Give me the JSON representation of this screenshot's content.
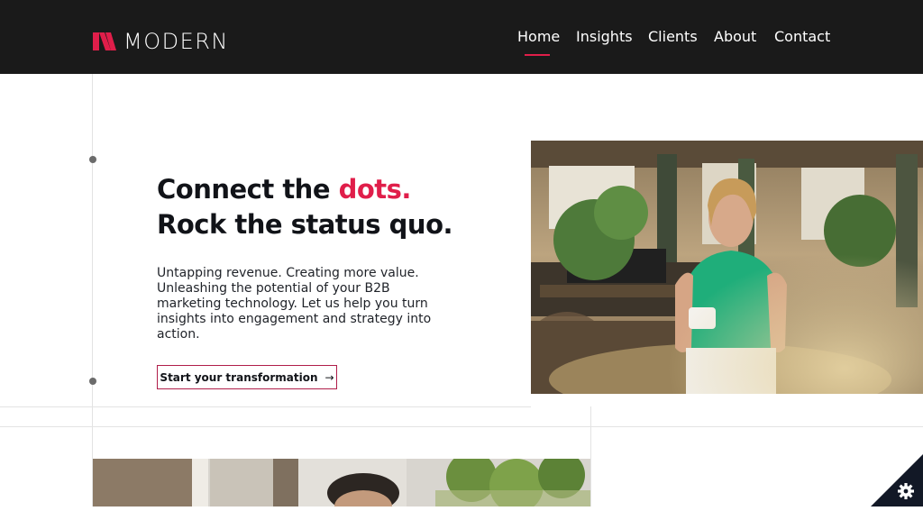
{
  "brand": {
    "name": "MODERN",
    "accent_color": "#e01e4a"
  },
  "nav": {
    "items": [
      {
        "label": "Home",
        "active": true
      },
      {
        "label": "Insights"
      },
      {
        "label": "Clients"
      },
      {
        "label": "About"
      },
      {
        "label": "Contact"
      }
    ]
  },
  "hero": {
    "title_line1_prefix": "Connect the ",
    "title_line1_accent": "dots.",
    "title_line2": "Rock the status quo.",
    "body": "Untapping revenue. Creating more value. Unleashing the potential of your B2B marketing technology. Let us help you turn insights into engagement and strategy into action.",
    "cta_label": "Start your transformation",
    "cta_icon": "arrow-right-icon"
  },
  "images": {
    "hero_photo": "office-woman-with-mug",
    "second_photo": "office-man-with-plants"
  },
  "widgets": {
    "settings_icon": "gear-icon"
  }
}
